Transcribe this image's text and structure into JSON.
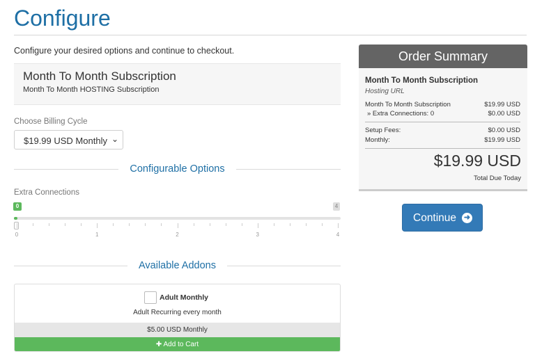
{
  "page": {
    "title": "Configure",
    "intro": "Configure your desired options and continue to checkout."
  },
  "product": {
    "name": "Month To Month Subscription",
    "description": "Month To Month HOSTING Subscription"
  },
  "billing": {
    "label": "Choose Billing Cycle",
    "selected": "$19.99 USD Monthly"
  },
  "sections": {
    "configurable_options": "Configurable Options",
    "available_addons": "Available Addons"
  },
  "extra_connections": {
    "label": "Extra Connections",
    "min_badge": "0",
    "max_badge": "4",
    "value": 0,
    "min": 0,
    "max": 4,
    "tick_labels": [
      "0",
      "1",
      "2",
      "3",
      "4"
    ]
  },
  "addon": {
    "name": "Adult Monthly",
    "description": "Adult Recurring every month",
    "price": "$5.00 USD Monthly",
    "add_label": "Add to Cart",
    "add_icon": "plus-icon",
    "checked": false
  },
  "summary": {
    "header": "Order Summary",
    "product_name": "Month To Month Subscription",
    "product_url": "Hosting URL",
    "lines": [
      {
        "label": "Month To Month Subscription",
        "value": "$19.99 USD"
      },
      {
        "label": "» Extra Connections: 0",
        "value": "$0.00 USD"
      }
    ],
    "fees": [
      {
        "label": "Setup Fees:",
        "value": "$0.00 USD"
      },
      {
        "label": "Monthly:",
        "value": "$19.99 USD"
      }
    ],
    "total": "$19.99 USD",
    "total_label": "Total Due Today"
  },
  "continue_button": {
    "label": "Continue",
    "icon": "arrow-circle-right-icon"
  },
  "colors": {
    "title_blue": "#1e6fa5",
    "success_green": "#5cb85c",
    "primary_blue": "#337ab7",
    "summary_header": "#646464"
  }
}
